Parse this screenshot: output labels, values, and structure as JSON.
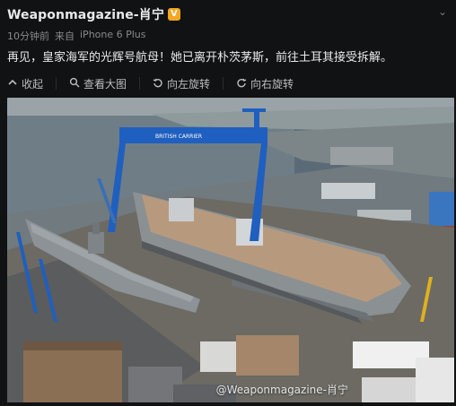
{
  "post": {
    "author": "Weaponmagazine-肖宁",
    "verified_mark": "V",
    "meta": {
      "time": "10分钟前",
      "source_prefix": "来自",
      "source": "iPhone 6 Plus"
    },
    "text": "再见，皇家海军的光辉号航母！她已离开朴茨茅斯，前往土耳其接受拆解。",
    "toolbar": {
      "collapse": "收起",
      "view_large": "查看大图",
      "rotate_left": "向左旋转",
      "rotate_right": "向右旋转"
    },
    "image": {
      "watermark": "@Weaponmagazine-肖宁",
      "crane_sign": "BRITISH CARRIER"
    }
  },
  "colors": {
    "background": "#111214",
    "text": "#eaeaea",
    "muted": "#8a8a8a",
    "verified": "#f5a623",
    "crane_blue": "#1f5fbf"
  },
  "icons": {
    "verified": "verified-badge-icon",
    "chevron": "chevron-down-icon",
    "collapse": "arrow-up-icon",
    "view_large": "magnifier-icon",
    "rotate_left": "rotate-left-icon",
    "rotate_right": "rotate-right-icon"
  }
}
